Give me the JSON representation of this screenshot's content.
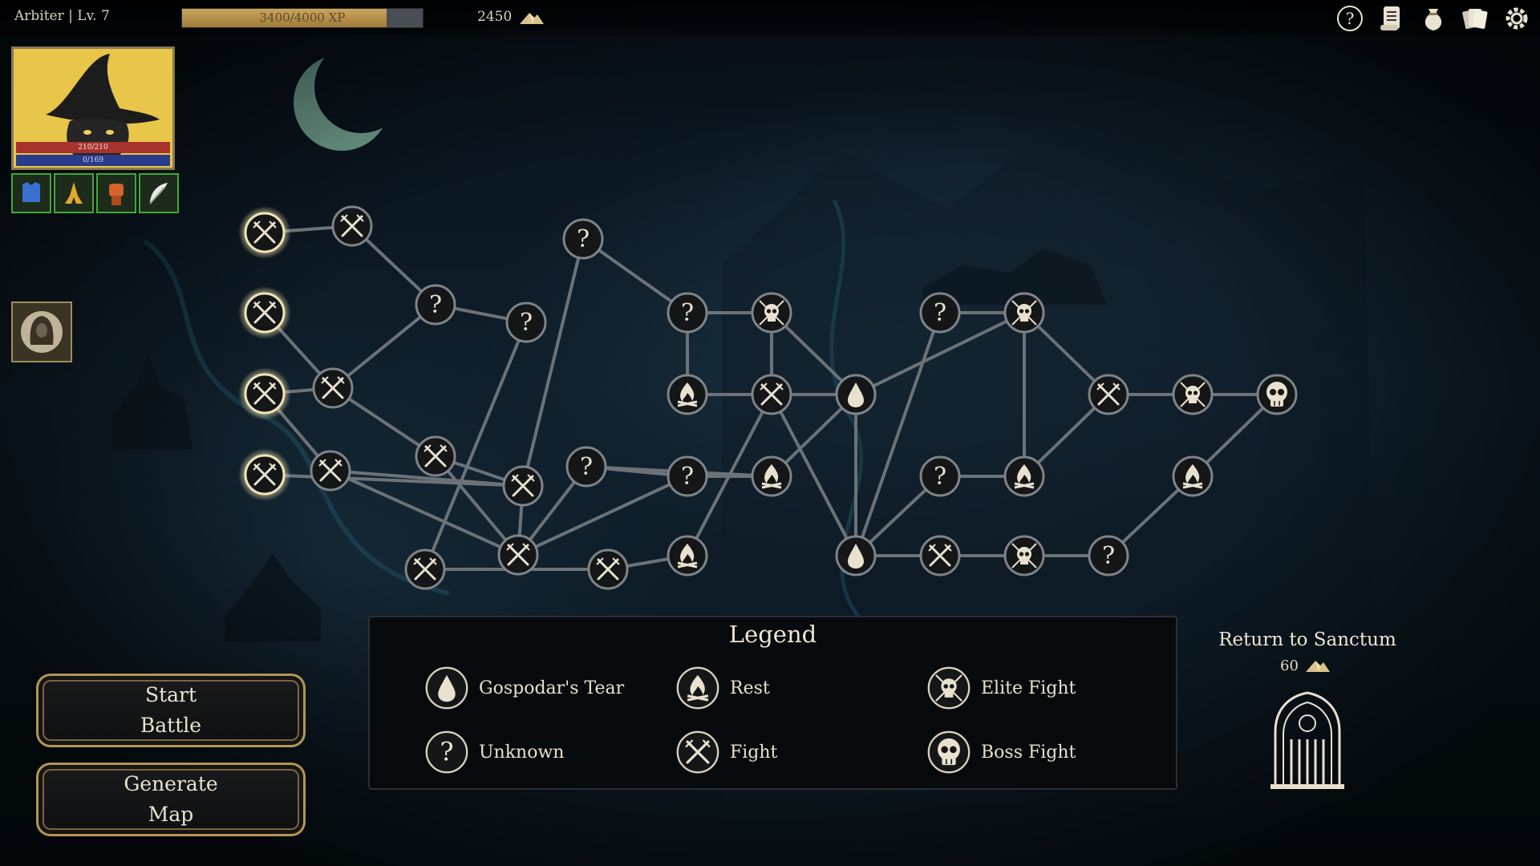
{
  "hud": {
    "player_label": "Arbiter | Lv. 7",
    "xp_text": "3400/4000 XP",
    "xp_fraction": 0.85,
    "gold": "2450",
    "hp_text": "210/210",
    "mp_text": "0/169",
    "icons": [
      "help-icon",
      "scroll-icon",
      "pouch-icon",
      "cards-icon",
      "settings-icon"
    ]
  },
  "buffs": [
    "armor-buff-icon",
    "prayer-buff-icon",
    "fist-buff-icon",
    "feather-buff-icon"
  ],
  "companion": {
    "icon": "hooded-companion-icon"
  },
  "legend": {
    "title": "Legend",
    "items": [
      {
        "type": "tear",
        "label": "Gospodar's Tear"
      },
      {
        "type": "rest",
        "label": "Rest"
      },
      {
        "type": "elite",
        "label": "Elite Fight"
      },
      {
        "type": "unknown",
        "label": "Unknown"
      },
      {
        "type": "fight",
        "label": "Fight"
      },
      {
        "type": "boss",
        "label": "Boss Fight"
      }
    ]
  },
  "buttons": {
    "start_battle": "Start\nBattle",
    "generate_map": "Generate\nMap"
  },
  "sanctum": {
    "title": "Return to Sanctum",
    "cost": "60"
  },
  "map": {
    "nodes": [
      {
        "id": "a1",
        "type": "fight",
        "available": true
      },
      {
        "id": "a2",
        "type": "fight",
        "available": true
      },
      {
        "id": "a3",
        "type": "fight",
        "available": true
      },
      {
        "id": "a4",
        "type": "fight",
        "available": true
      },
      {
        "id": "b1",
        "type": "fight"
      },
      {
        "id": "b2",
        "type": "fight"
      },
      {
        "id": "b3",
        "type": "fight"
      },
      {
        "id": "c1",
        "type": "unknown"
      },
      {
        "id": "c2",
        "type": "unknown"
      },
      {
        "id": "c3",
        "type": "fight"
      },
      {
        "id": "c4",
        "type": "fight"
      },
      {
        "id": "d1",
        "type": "unknown"
      },
      {
        "id": "d2",
        "type": "fight"
      },
      {
        "id": "d3",
        "type": "fight"
      },
      {
        "id": "d4",
        "type": "unknown"
      },
      {
        "id": "e1",
        "type": "fight"
      },
      {
        "id": "e2",
        "type": "unknown"
      },
      {
        "id": "e3",
        "type": "unknown"
      },
      {
        "id": "f1",
        "type": "rest"
      },
      {
        "id": "f2",
        "type": "elite"
      },
      {
        "id": "f3",
        "type": "rest"
      },
      {
        "id": "f4",
        "type": "rest"
      },
      {
        "id": "g1",
        "type": "fight"
      },
      {
        "id": "g2",
        "type": "unknown"
      },
      {
        "id": "h1",
        "type": "tear"
      },
      {
        "id": "h2",
        "type": "tear"
      },
      {
        "id": "i1",
        "type": "fight"
      },
      {
        "id": "i2",
        "type": "unknown"
      },
      {
        "id": "i3",
        "type": "unknown"
      },
      {
        "id": "i4",
        "type": "fight"
      },
      {
        "id": "j1",
        "type": "elite"
      },
      {
        "id": "j2",
        "type": "elite"
      },
      {
        "id": "j3",
        "type": "rest"
      },
      {
        "id": "k1",
        "type": "unknown"
      },
      {
        "id": "k2",
        "type": "fight"
      },
      {
        "id": "l1",
        "type": "rest"
      },
      {
        "id": "l2",
        "type": "elite"
      },
      {
        "id": "m1",
        "type": "boss"
      }
    ],
    "edges": [
      [
        "a1",
        "b1"
      ],
      [
        "b1",
        "c1"
      ],
      [
        "c1",
        "c2"
      ],
      [
        "c2",
        "d2"
      ],
      [
        "d2",
        "e1"
      ],
      [
        "e1",
        "f1"
      ],
      [
        "f1",
        "g1"
      ],
      [
        "a2",
        "b2"
      ],
      [
        "b2",
        "c3"
      ],
      [
        "c3",
        "c4"
      ],
      [
        "c4",
        "d1"
      ],
      [
        "d1",
        "e2"
      ],
      [
        "e2",
        "f2"
      ],
      [
        "f2",
        "g1"
      ],
      [
        "a3",
        "b3"
      ],
      [
        "b3",
        "d3"
      ],
      [
        "d3",
        "c3"
      ],
      [
        "c3",
        "d3"
      ],
      [
        "a4",
        "c4"
      ],
      [
        "b3",
        "c4"
      ],
      [
        "c4",
        "d3"
      ],
      [
        "d3",
        "d4"
      ],
      [
        "d3",
        "e3"
      ],
      [
        "a3",
        "b2"
      ],
      [
        "b2",
        "c1"
      ],
      [
        "d4",
        "e3"
      ],
      [
        "e3",
        "f3"
      ],
      [
        "f3",
        "g2"
      ],
      [
        "g2",
        "h1"
      ],
      [
        "d4",
        "f3"
      ],
      [
        "e2",
        "f4"
      ],
      [
        "f4",
        "g2"
      ],
      [
        "g2",
        "h2"
      ],
      [
        "c4",
        "d3"
      ],
      [
        "g1",
        "h1"
      ],
      [
        "h1",
        "i1"
      ],
      [
        "i1",
        "j1"
      ],
      [
        "j1",
        "k1"
      ],
      [
        "k1",
        "l1"
      ],
      [
        "l1",
        "m1"
      ],
      [
        "h1",
        "i2"
      ],
      [
        "i2",
        "j2"
      ],
      [
        "j2",
        "k2"
      ],
      [
        "h1",
        "i3"
      ],
      [
        "i3",
        "j3"
      ],
      [
        "h2",
        "i4"
      ],
      [
        "i4",
        "j3"
      ],
      [
        "j3",
        "k2"
      ],
      [
        "k2",
        "l2"
      ],
      [
        "l2",
        "m1"
      ],
      [
        "f2",
        "g2"
      ]
    ]
  }
}
